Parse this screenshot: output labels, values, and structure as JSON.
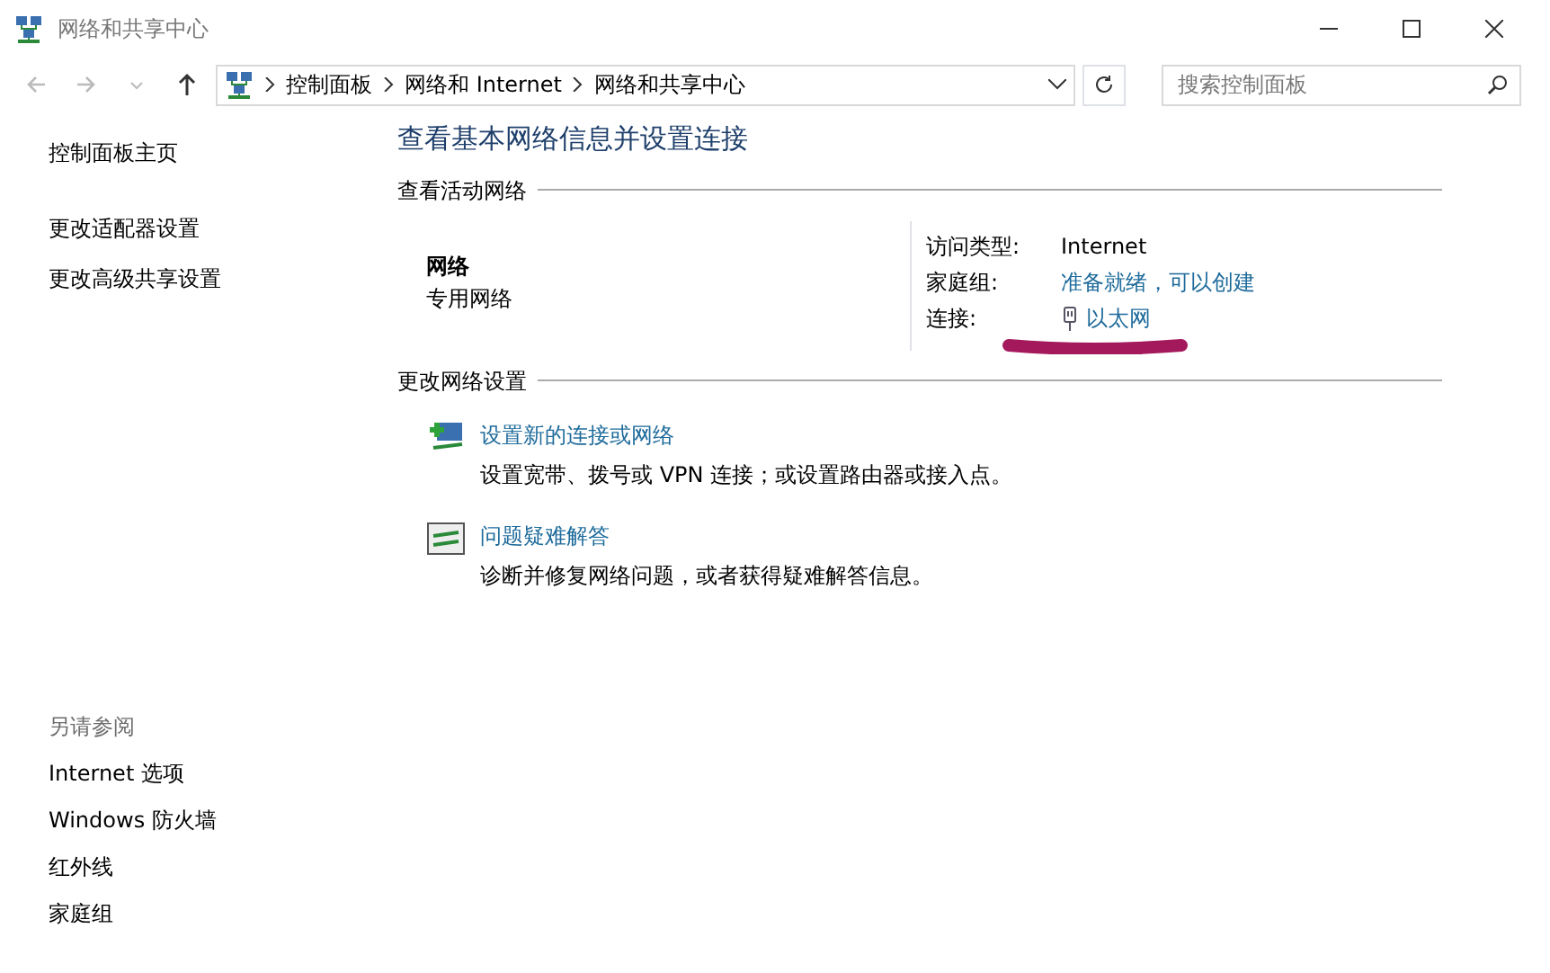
{
  "window": {
    "title": "网络和共享中心"
  },
  "nav": [
    {
      "kind": "back",
      "disabled": true
    },
    {
      "kind": "forward",
      "disabled": true
    },
    {
      "kind": "recent",
      "disabled": true
    },
    {
      "kind": "up",
      "disabled": false
    }
  ],
  "breadcrumb": [
    "控制面板",
    "网络和 Internet",
    "网络和共享中心"
  ],
  "search": {
    "placeholder": "搜索控制面板"
  },
  "sidebar": {
    "items": [
      "控制面板主页",
      "更改适配器设置",
      "更改高级共享设置"
    ],
    "see_also_title": "另请参阅",
    "see_also": [
      "Internet 选项",
      "Windows 防火墙",
      "红外线",
      "家庭组"
    ]
  },
  "main": {
    "title": "查看基本网络信息并设置连接",
    "active_section": "查看活动网络",
    "network": {
      "name": "网络",
      "type": "专用网络"
    },
    "details": [
      {
        "label": "访问类型:",
        "value": "Internet",
        "kind": "text"
      },
      {
        "label": "家庭组:",
        "value": "准备就绪，可以创建",
        "kind": "link"
      },
      {
        "label": "连接:",
        "value": "以太网",
        "kind": "ethernet"
      }
    ],
    "change_section": "更改网络设置",
    "tasks": [
      {
        "kind": "new-connection",
        "title": "设置新的连接或网络",
        "desc": "设置宽带、拨号或 VPN 连接；或设置路由器或接入点。"
      },
      {
        "kind": "troubleshoot",
        "title": "问题疑难解答",
        "desc": "诊断并修复网络问题，或者获得疑难解答信息。"
      }
    ]
  }
}
